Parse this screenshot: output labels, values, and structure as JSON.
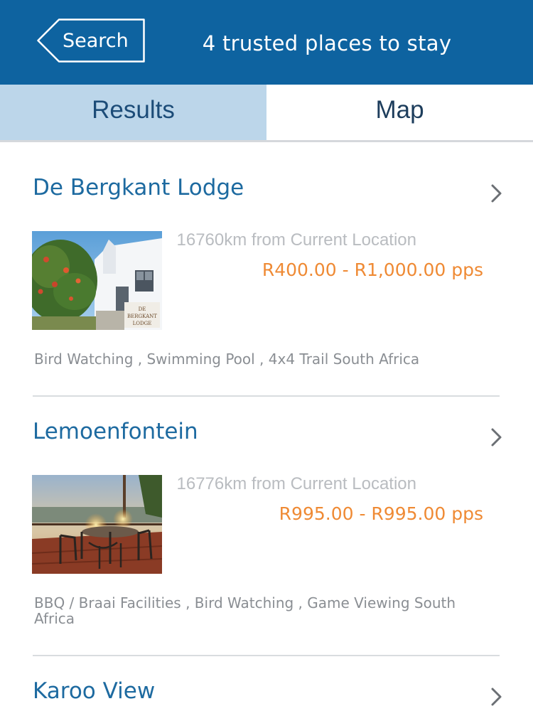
{
  "header": {
    "back_label": "Search",
    "title": "4 trusted places to stay"
  },
  "tabs": [
    {
      "label": "Results",
      "selected": true
    },
    {
      "label": "Map",
      "selected": false
    }
  ],
  "listings": [
    {
      "name": "De Bergkant Lodge",
      "distance": "16760km from Current Location",
      "price": "R400.00 - R1,000.00 pps",
      "amenities": "Bird Watching , Swimming Pool , 4x4 Trail South Africa",
      "sign_text": "DE BERGKANT LODGE"
    },
    {
      "name": "Lemoenfontein",
      "distance": "16776km from Current Location",
      "price": "R995.00 - R995.00 pps",
      "amenities": "BBQ / Braai Facilities , Bird Watching , Game Viewing South Africa"
    },
    {
      "name": "Karoo View"
    }
  ],
  "colors": {
    "header_bg": "#0e63a0",
    "tab_selected_bg": "#bcd6ea",
    "title_blue": "#1d6aa0",
    "price_orange": "#ef8a34"
  },
  "icons": {
    "back": "back-arrow-button-icon",
    "chevron": "chevron-right-icon"
  }
}
